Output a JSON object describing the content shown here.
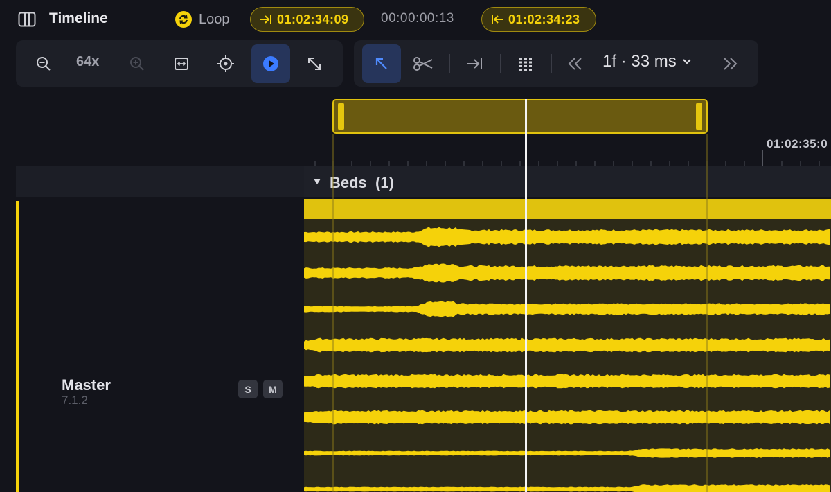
{
  "header": {
    "title": "Timeline",
    "loop_label": "Loop",
    "in_point": "01:02:34:09",
    "duration": "00:00:00:13",
    "out_point": "01:02:34:23"
  },
  "toolbar": {
    "zoom_level": "64x",
    "frame_step": "1f · 33 ms"
  },
  "ruler": {
    "time_label": "01:02:35:0"
  },
  "tracks": {
    "group_label": "Beds",
    "group_count": "(1)",
    "master": {
      "name": "Master",
      "format": "7.1.2",
      "solo_label": "S",
      "mute_label": "M"
    }
  },
  "colors": {
    "accent": "#f5d20a",
    "background": "#13141b",
    "active_tool": "#26355b",
    "play_blue": "#3b7bff"
  }
}
